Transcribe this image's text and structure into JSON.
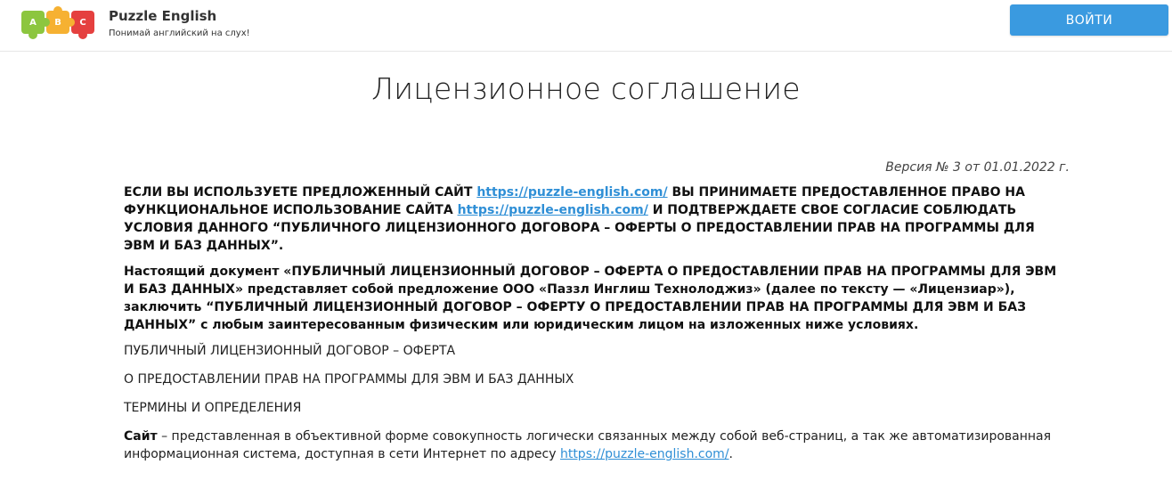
{
  "header": {
    "logo": {
      "letters": [
        "A",
        "B",
        "C"
      ],
      "title": "Puzzle English",
      "tagline": "Понимай английский на слух!"
    },
    "login_label": "ВОЙТИ"
  },
  "page": {
    "title": "Лицензионное соглашение",
    "version": "Версия № 3 от 01.01.2022 г."
  },
  "intro": {
    "part1": "ЕСЛИ ВЫ ИСПОЛЬЗУЕТЕ ПРЕДЛОЖЕННЫЙ САЙТ ",
    "link1": "https://puzzle-english.com/",
    "part2": " ВЫ ПРИНИМАЕТЕ ПРЕДОСТАВЛЕННОЕ ПРАВО НА ФУНКЦИОНАЛЬНОЕ ИСПОЛЬЗОВАНИЕ САЙТА ",
    "link2": "https://puzzle-english.com/",
    "part3": " И ПОДТВЕРЖДАЕТЕ СВОЕ СОГЛАСИЕ СОБЛЮДАТЬ УСЛОВИЯ ДАННОГО “ПУБЛИЧНОГО ЛИЦЕНЗИОННОГО ДОГОВОРА – ОФЕРТЫ О ПРЕДОСТАВЛЕНИИ ПРАВ НА ПРОГРАММЫ ДЛЯ ЭВМ И БАЗ ДАННЫХ”."
  },
  "document_para": "Настоящий документ «ПУБЛИЧНЫЙ ЛИЦЕНЗИОННЫЙ ДОГОВОР – ОФЕРТА О ПРЕДОСТАВЛЕНИИ ПРАВ НА ПРОГРАММЫ ДЛЯ ЭВМ И БАЗ ДАННЫХ» представляет собой предложение ООО «Паззл Инглиш Технолоджиз» (далее по тексту — «Лицензиар»), заключить “ПУБЛИЧНЫЙ ЛИЦЕНЗИОННЫЙ ДОГОВОР – ОФЕРТУ О ПРЕДОСТАВЛЕНИИ ПРАВ НА ПРОГРАММЫ ДЛЯ ЭВМ И БАЗ ДАННЫХ” с любым заинтересованным физическим или юридическим лицом на изложенных ниже условиях.",
  "headings": [
    "ПУБЛИЧНЫЙ ЛИЦЕНЗИОННЫЙ ДОГОВОР – ОФЕРТА",
    "О ПРЕДОСТАВЛЕНИИ ПРАВ НА ПРОГРАММЫ ДЛЯ ЭВМ И БАЗ ДАННЫХ",
    "ТЕРМИНЫ И ОПРЕДЕЛЕНИЯ"
  ],
  "site_definition": {
    "term": "Сайт",
    "text": " – представленная в объективной форме совокупность логически связанных между собой веб-страниц, а так же автоматизированная информационная система, доступная в сети Интернет по адресу ",
    "link": "https://puzzle-english.com/",
    "end": "."
  }
}
